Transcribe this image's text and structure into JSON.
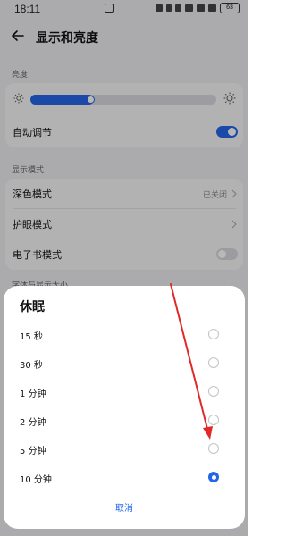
{
  "status_bar": {
    "time": "18:11",
    "battery": "63"
  },
  "header": {
    "title": "显示和亮度"
  },
  "brightness_section": {
    "label": "亮度",
    "level_percent": 34,
    "auto_adjust_label": "自动调节",
    "auto_adjust_on": true
  },
  "display_mode_section": {
    "label": "显示模式",
    "dark_mode_label": "深色模式",
    "dark_mode_value": "已关闭",
    "eye_comfort_label": "护眼模式",
    "ebook_mode_label": "电子书模式",
    "ebook_mode_on": false,
    "partial_next_label": "字体与显示大小"
  },
  "sleep_sheet": {
    "title": "休眠",
    "options": [
      {
        "label": "15 秒",
        "selected": false
      },
      {
        "label": "30 秒",
        "selected": false
      },
      {
        "label": "1 分钟",
        "selected": false
      },
      {
        "label": "2 分钟",
        "selected": false
      },
      {
        "label": "5 分钟",
        "selected": false
      },
      {
        "label": "10 分钟",
        "selected": true
      }
    ],
    "cancel_label": "取消"
  },
  "colors": {
    "accent": "#2566e8",
    "annotation_arrow": "#e02a2a"
  }
}
